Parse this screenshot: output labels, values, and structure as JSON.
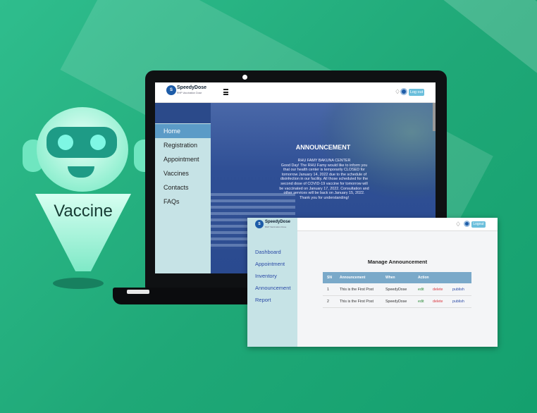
{
  "robot": {
    "label": "Vaccine"
  },
  "site": {
    "logo_name": "SpeedyDose",
    "logo_tagline": "RHP Vaccination Dose",
    "logout_label": "Log out",
    "nav": [
      "Home",
      "Registration",
      "Appointment",
      "Vaccines",
      "Contacts",
      "FAQs"
    ],
    "active_nav": "Home",
    "announcement": {
      "title": "ANNOUNCEMENT",
      "heading": "RHU FAMY BAKUNA CENTER",
      "body": "Good Day! The RHU Famy would like to inform you that our health center is temporarily CLOSED for tomorrow January 14, 2022 due to the schedule of disinfection in our facility. All those scheduled for the second dose of COVID-19 vaccine for tomorrow will be vaccinated on January 17, 2022. Consultation and other services will be back on January 15, 2022.",
      "thanks": "Thank you for understanding!"
    }
  },
  "admin": {
    "logo_name": "SpeedyDose",
    "logo_tagline": "RHP Vaccination Dose",
    "logout_label": "Logout",
    "nav": [
      "Dashboard",
      "Appointment",
      "Inventory",
      "Announcement",
      "Report"
    ],
    "page_title": "Manage Announcement",
    "table": {
      "columns": [
        "SN",
        "Announcement",
        "When",
        "Action"
      ],
      "rows": [
        {
          "sn": "1",
          "announcement": "This is the First Post",
          "when": "SpeedyDose",
          "edit": "edit",
          "delete": "delete",
          "publish": "publish"
        },
        {
          "sn": "2",
          "announcement": "This is the First Post",
          "when": "SpeedyDose",
          "edit": "edit",
          "delete": "delete",
          "publish": "publish"
        }
      ]
    }
  },
  "colors": {
    "background": "#27b183",
    "sidebar": "#c6e3e6",
    "nav_active": "#5b9bc7",
    "table_header": "#7aa9c9",
    "edit": "#2e8b3a",
    "delete": "#d9363e",
    "publish": "#2a4aa6"
  },
  "icons": [
    "bell-icon",
    "menu-icon",
    "avatar-icon",
    "logo-icon"
  ]
}
